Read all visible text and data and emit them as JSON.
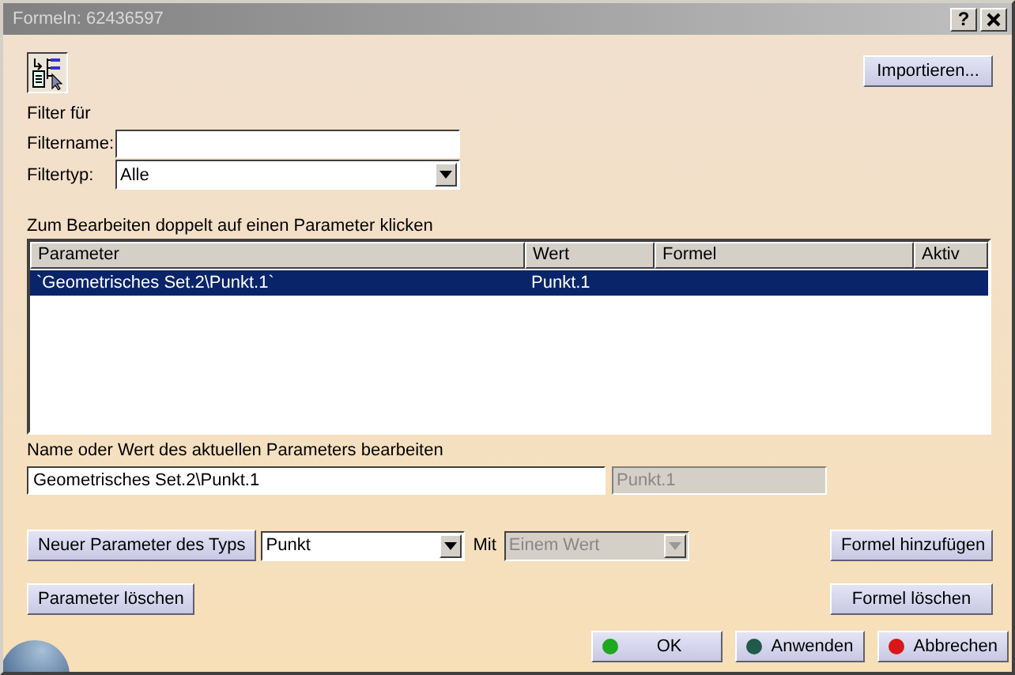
{
  "window": {
    "title": "Formeln: 62436597",
    "help": "?"
  },
  "import_button": "Importieren...",
  "filter": {
    "heading": "Filter für",
    "name_label": "Filtername:",
    "type_label": "Filtertyp:",
    "type_value": "Alle"
  },
  "table": {
    "caption": "Zum Bearbeiten doppelt auf einen Parameter klicken",
    "columns": [
      "Parameter",
      "Wert",
      "Formel",
      "Aktiv"
    ],
    "rows": [
      {
        "cells": [
          "`Geometrisches Set.2\\Punkt.1`",
          "Punkt.1",
          "",
          ""
        ],
        "selected": true
      }
    ]
  },
  "edit": {
    "caption": "Name oder Wert des aktuellen Parameters bearbeiten",
    "name_value": "Geometrisches Set.2\\Punkt.1",
    "value": "Punkt.1",
    "value_disabled": true
  },
  "new_param": {
    "button": "Neuer Parameter des Typs",
    "type_value": "Punkt",
    "with_label": "Mit",
    "with_value": "Einem Wert",
    "with_disabled": true
  },
  "add_formula": "Formel hinzufügen",
  "delete_param": "Parameter löschen",
  "delete_formula": "Formel löschen",
  "dialog_buttons": [
    {
      "label": "OK",
      "color": "#1fa81f"
    },
    {
      "label": "Anwenden",
      "color": "#1f5a4a"
    },
    {
      "label": "Abbrechen",
      "color": "#d81818"
    }
  ]
}
